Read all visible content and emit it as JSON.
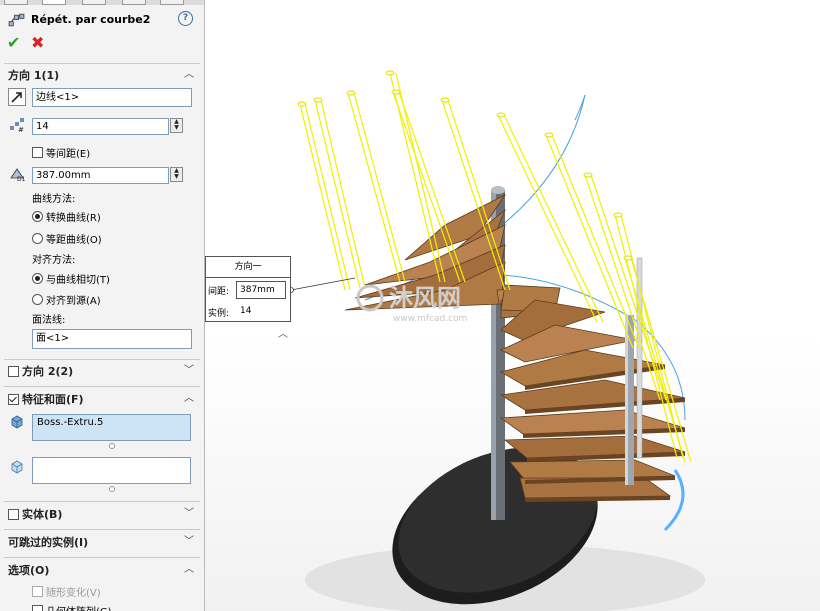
{
  "feature": {
    "title": "Répét. par courbe2"
  },
  "direction1": {
    "header": "方向 1(1)",
    "edge_value": "边线<1>",
    "instances_value": "14",
    "equal_spacing_label": "等间距(E)",
    "spacing_value": "387.00mm",
    "curve_method_label": "曲线方法:",
    "curve_method_options": [
      "转换曲线(R)",
      "等距曲线(O)"
    ],
    "align_method_label": "对齐方法:",
    "align_method_options": [
      "与曲线相切(T)",
      "对齐到源(A)"
    ],
    "face_normal_label": "面法线:",
    "face_value": "面<1>"
  },
  "direction2": {
    "header": "方向 2(2)"
  },
  "features_faces": {
    "header": "特征和面(F)",
    "feature_item": "Boss.-Extru.5"
  },
  "bodies": {
    "header": "实体(B)"
  },
  "skip_instances": {
    "header": "可跳过的实例(I)"
  },
  "options": {
    "header": "选项(O)",
    "items": [
      "随形变化(V)",
      "几何体阵列(G)"
    ]
  },
  "callout": {
    "title": "方向一",
    "spacing_label": "间距:",
    "spacing_value": "387mm",
    "instances_label": "实例:",
    "instances_value": "14"
  },
  "watermark": {
    "text": "沐风网",
    "url": "www.mfcad.com"
  },
  "colors": {
    "accent": "#3a6ea5",
    "ok": "#2ca02c",
    "cancel": "#d9231b",
    "selection": "#cde4f7",
    "wood": "#b07a44",
    "curve_yellow": "#f2f000",
    "curve_blue": "#4aa3df"
  }
}
